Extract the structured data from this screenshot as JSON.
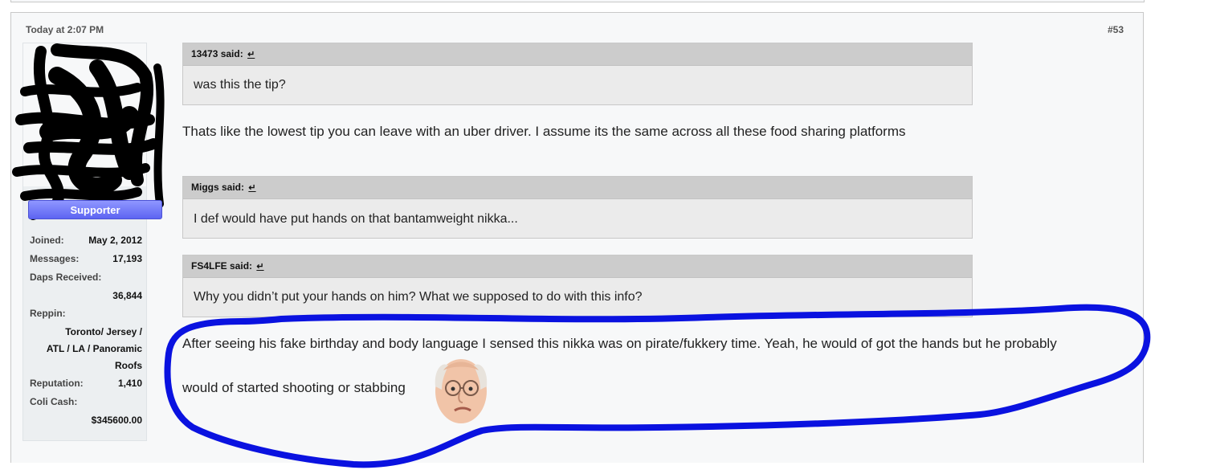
{
  "post": {
    "date": "Today at 2:07 PM",
    "number": "#53"
  },
  "user": {
    "title": "Supporter",
    "stats": {
      "joined_label": "Joined:",
      "joined_value": "May 2, 2012",
      "messages_label": "Messages:",
      "messages_value": "17,193",
      "daps_label": "Daps Received:",
      "daps_value": "36,844",
      "reppin_label": "Reppin:",
      "reppin_value_1": "Toronto/ Jersey /",
      "reppin_value_2": "ATL / LA / Panoramic",
      "reppin_value_3": "Roofs",
      "reputation_label": "Reputation:",
      "reputation_value": "1,410",
      "colicash_label": "Coli Cash:",
      "colicash_value": "$345600.00"
    }
  },
  "quotes": [
    {
      "author": "13473 said:",
      "arrow": "↵",
      "text": "was this the tip?"
    },
    {
      "author": "Miggs said:",
      "arrow": "↵",
      "text": "I def would have put hands on that bantamweight nikka..."
    },
    {
      "author": "FS4LFE said:",
      "arrow": "↵",
      "text": "Why you didn’t put your hands on him? What we supposed to do with this info?"
    }
  ],
  "messages": {
    "reply_1": "Thats like the lowest tip you can leave with an uber driver. I assume its the same across all these food sharing platforms",
    "reply_2_line_1": "After seeing his fake birthday and body language I sensed this nikka was on pirate/fukkery time. Yeah, he would of got the hands but he probably",
    "reply_2_line_2": "would of started shooting or stabbing"
  },
  "colors": {
    "user_title_bg": "#6a71f5",
    "annotation_circle": "#0a12e0",
    "quote_header_bg": "#cccccc",
    "quote_body_bg": "#ebebeb",
    "post_bg": "#f7f8f9"
  },
  "icons": {
    "quote_jump": "return-arrow-icon",
    "reaction": "larry-david-face-emoji"
  }
}
